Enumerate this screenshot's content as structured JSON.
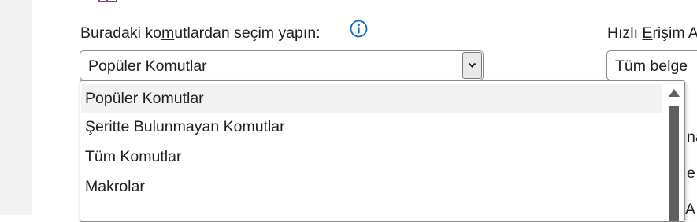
{
  "choose_commands": {
    "label_before": "Buradaki ko",
    "label_accel": "m",
    "label_after": "utlardan seçim yapın:",
    "info_icon": "info-icon",
    "selected_value": "Popüler Komutlar",
    "dropdown_icon": "chevron-down-icon",
    "options": [
      "Popüler Komutlar",
      "Şeritte Bulunmayan Komutlar",
      "Tüm Komutlar",
      "Makrolar"
    ]
  },
  "quick_access": {
    "label_before": "Hızlı ",
    "label_accel": "E",
    "label_after": "rişim A",
    "selected_value": "Tüm belge"
  },
  "background_fragments": [
    "na",
    "e",
    "A"
  ],
  "colors": {
    "info_accent": "#0f6cbd",
    "top_icon": "#9b2fae"
  }
}
